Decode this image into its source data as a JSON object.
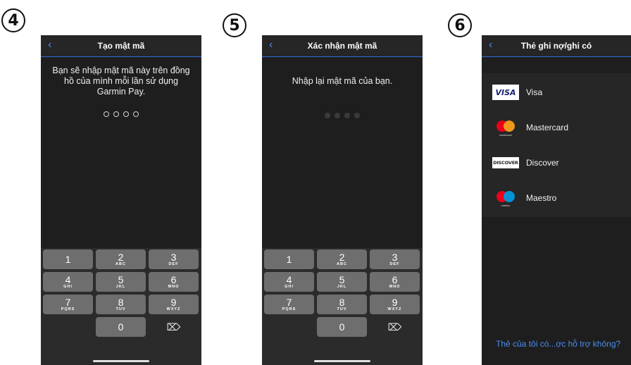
{
  "steps": [
    "4",
    "5",
    "6"
  ],
  "screen4": {
    "title": "Tạo mật mã",
    "message": "Bạn sẽ nhập mật mã này trên đồng hồ của mình mỗi lần sử dụng Garmin Pay."
  },
  "screen5": {
    "title": "Xác nhận mật mã",
    "message": "Nhập lại mật mã của bạn."
  },
  "keypad": {
    "keys": [
      {
        "num": "1",
        "letters": ""
      },
      {
        "num": "2",
        "letters": "ABC"
      },
      {
        "num": "3",
        "letters": "DEF"
      },
      {
        "num": "4",
        "letters": "GHI"
      },
      {
        "num": "5",
        "letters": "JKL"
      },
      {
        "num": "6",
        "letters": "MNO"
      },
      {
        "num": "7",
        "letters": "PQRS"
      },
      {
        "num": "8",
        "letters": "TUV"
      },
      {
        "num": "9",
        "letters": "WXYZ"
      },
      {
        "num": "0",
        "letters": ""
      }
    ]
  },
  "screen6": {
    "title": "Thẻ ghi nợ/ghi có",
    "cards": [
      {
        "name": "Visa",
        "logo_text": "VISA"
      },
      {
        "name": "Mastercard",
        "logo_text": "mastercard"
      },
      {
        "name": "Discover",
        "logo_text": "DISCOVER"
      },
      {
        "name": "Maestro",
        "logo_text": "maestro"
      }
    ],
    "help_link": "Thẻ của tôi có...ợc hỗ trợ không?"
  },
  "icons": {
    "back": "chevron-left-icon",
    "backspace": "backspace-icon"
  }
}
